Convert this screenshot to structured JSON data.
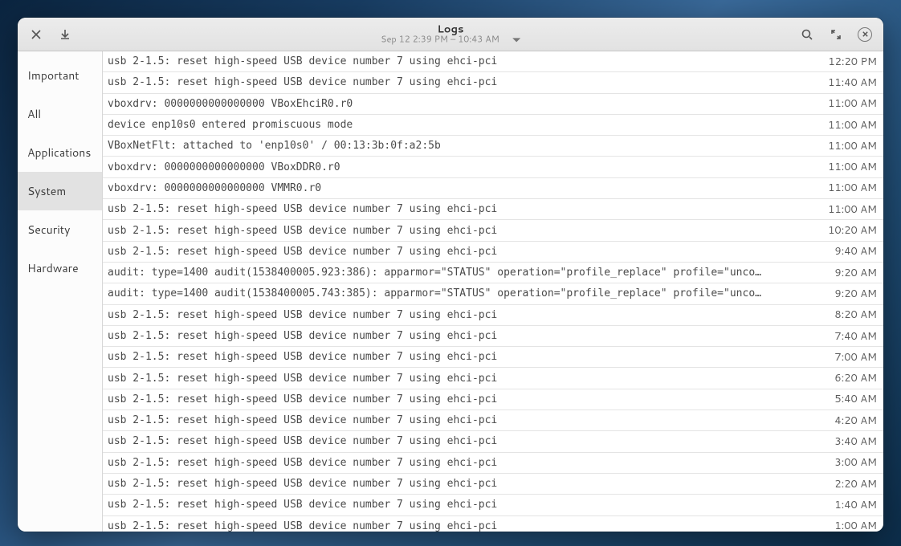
{
  "header": {
    "title": "Logs",
    "subtitle": "Sep 12  2:39 PM – 10:43 AM"
  },
  "sidebar": {
    "items": [
      {
        "label": "Important",
        "selected": false
      },
      {
        "label": "All",
        "selected": false
      },
      {
        "label": "Applications",
        "selected": false
      },
      {
        "label": "System",
        "selected": true
      },
      {
        "label": "Security",
        "selected": false
      },
      {
        "label": "Hardware",
        "selected": false
      }
    ]
  },
  "logs": [
    {
      "message": "usb 2-1.5: reset high-speed USB device number 7 using ehci-pci",
      "time": "12:20 PM"
    },
    {
      "message": "usb 2-1.5: reset high-speed USB device number 7 using ehci-pci",
      "time": "11:40 AM"
    },
    {
      "message": "vboxdrv: 0000000000000000 VBoxEhciR0.r0",
      "time": "11:00 AM"
    },
    {
      "message": "device enp10s0 entered promiscuous mode",
      "time": "11:00 AM"
    },
    {
      "message": "VBoxNetFlt: attached to 'enp10s0' / 00:13:3b:0f:a2:5b",
      "time": "11:00 AM"
    },
    {
      "message": "vboxdrv: 0000000000000000 VBoxDDR0.r0",
      "time": "11:00 AM"
    },
    {
      "message": "vboxdrv: 0000000000000000 VMMR0.r0",
      "time": "11:00 AM"
    },
    {
      "message": "usb 2-1.5: reset high-speed USB device number 7 using ehci-pci",
      "time": "11:00 AM"
    },
    {
      "message": "usb 2-1.5: reset high-speed USB device number 7 using ehci-pci",
      "time": "10:20 AM"
    },
    {
      "message": "usb 2-1.5: reset high-speed USB device number 7 using ehci-pci",
      "time": "9:40 AM"
    },
    {
      "message": "audit: type=1400 audit(1538400005.923:386): apparmor=\"STATUS\" operation=\"profile_replace\" profile=\"unco…",
      "time": "9:20 AM"
    },
    {
      "message": "audit: type=1400 audit(1538400005.743:385): apparmor=\"STATUS\" operation=\"profile_replace\" profile=\"unco…",
      "time": "9:20 AM"
    },
    {
      "message": "usb 2-1.5: reset high-speed USB device number 7 using ehci-pci",
      "time": "8:20 AM"
    },
    {
      "message": "usb 2-1.5: reset high-speed USB device number 7 using ehci-pci",
      "time": "7:40 AM"
    },
    {
      "message": "usb 2-1.5: reset high-speed USB device number 7 using ehci-pci",
      "time": "7:00 AM"
    },
    {
      "message": "usb 2-1.5: reset high-speed USB device number 7 using ehci-pci",
      "time": "6:20 AM"
    },
    {
      "message": "usb 2-1.5: reset high-speed USB device number 7 using ehci-pci",
      "time": "5:40 AM"
    },
    {
      "message": "usb 2-1.5: reset high-speed USB device number 7 using ehci-pci",
      "time": "4:20 AM"
    },
    {
      "message": "usb 2-1.5: reset high-speed USB device number 7 using ehci-pci",
      "time": "3:40 AM"
    },
    {
      "message": "usb 2-1.5: reset high-speed USB device number 7 using ehci-pci",
      "time": "3:00 AM"
    },
    {
      "message": "usb 2-1.5: reset high-speed USB device number 7 using ehci-pci",
      "time": "2:20 AM"
    },
    {
      "message": "usb 2-1.5: reset high-speed USB device number 7 using ehci-pci",
      "time": "1:40 AM"
    },
    {
      "message": "usb 2-1.5: reset high-speed USB device number 7 using ehci-pci",
      "time": "1:00 AM"
    }
  ]
}
